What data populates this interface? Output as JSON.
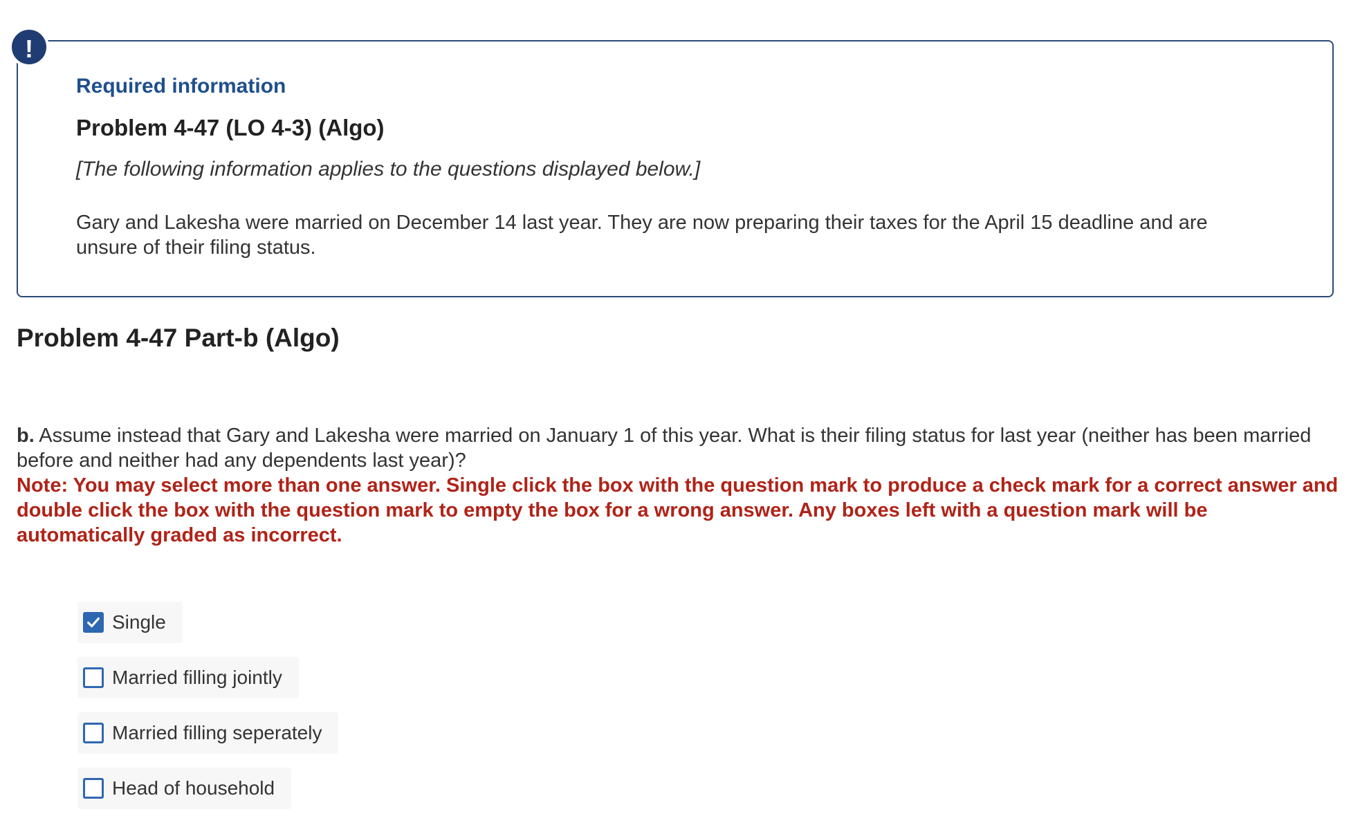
{
  "info_box": {
    "alert_symbol": "!",
    "required_label": "Required information",
    "problem_title": "Problem 4-47 (LO 4-3) (Algo)",
    "italic_note": "[The following information applies to the questions displayed below.]",
    "body": "Gary and Lakesha were married on December 14 last year. They are now preparing their taxes for the April 15 deadline and are unsure of their filing status."
  },
  "part_heading": "Problem 4-47 Part-b (Algo)",
  "question": {
    "prefix": "b.",
    "text": " Assume instead that Gary and Lakesha were married on January 1 of this year. What is their filing status for last year (neither has been married before and neither had any dependents last year)?"
  },
  "note": "Note: You may select more than one answer. Single click the box with the question mark to produce a check mark for a correct answer and double click the box with the question mark to empty the box for a wrong answer. Any boxes left with a question mark will be automatically graded as incorrect.",
  "options": [
    {
      "label": "Single",
      "checked": true
    },
    {
      "label": "Married filling jointly",
      "checked": false
    },
    {
      "label": "Married filling seperately",
      "checked": false
    },
    {
      "label": "Head of household",
      "checked": false
    }
  ],
  "colors": {
    "accent_blue": "#2e67b1",
    "heading_blue": "#1f4e8c",
    "badge_navy": "#1f3d73",
    "note_red": "#b02318"
  }
}
